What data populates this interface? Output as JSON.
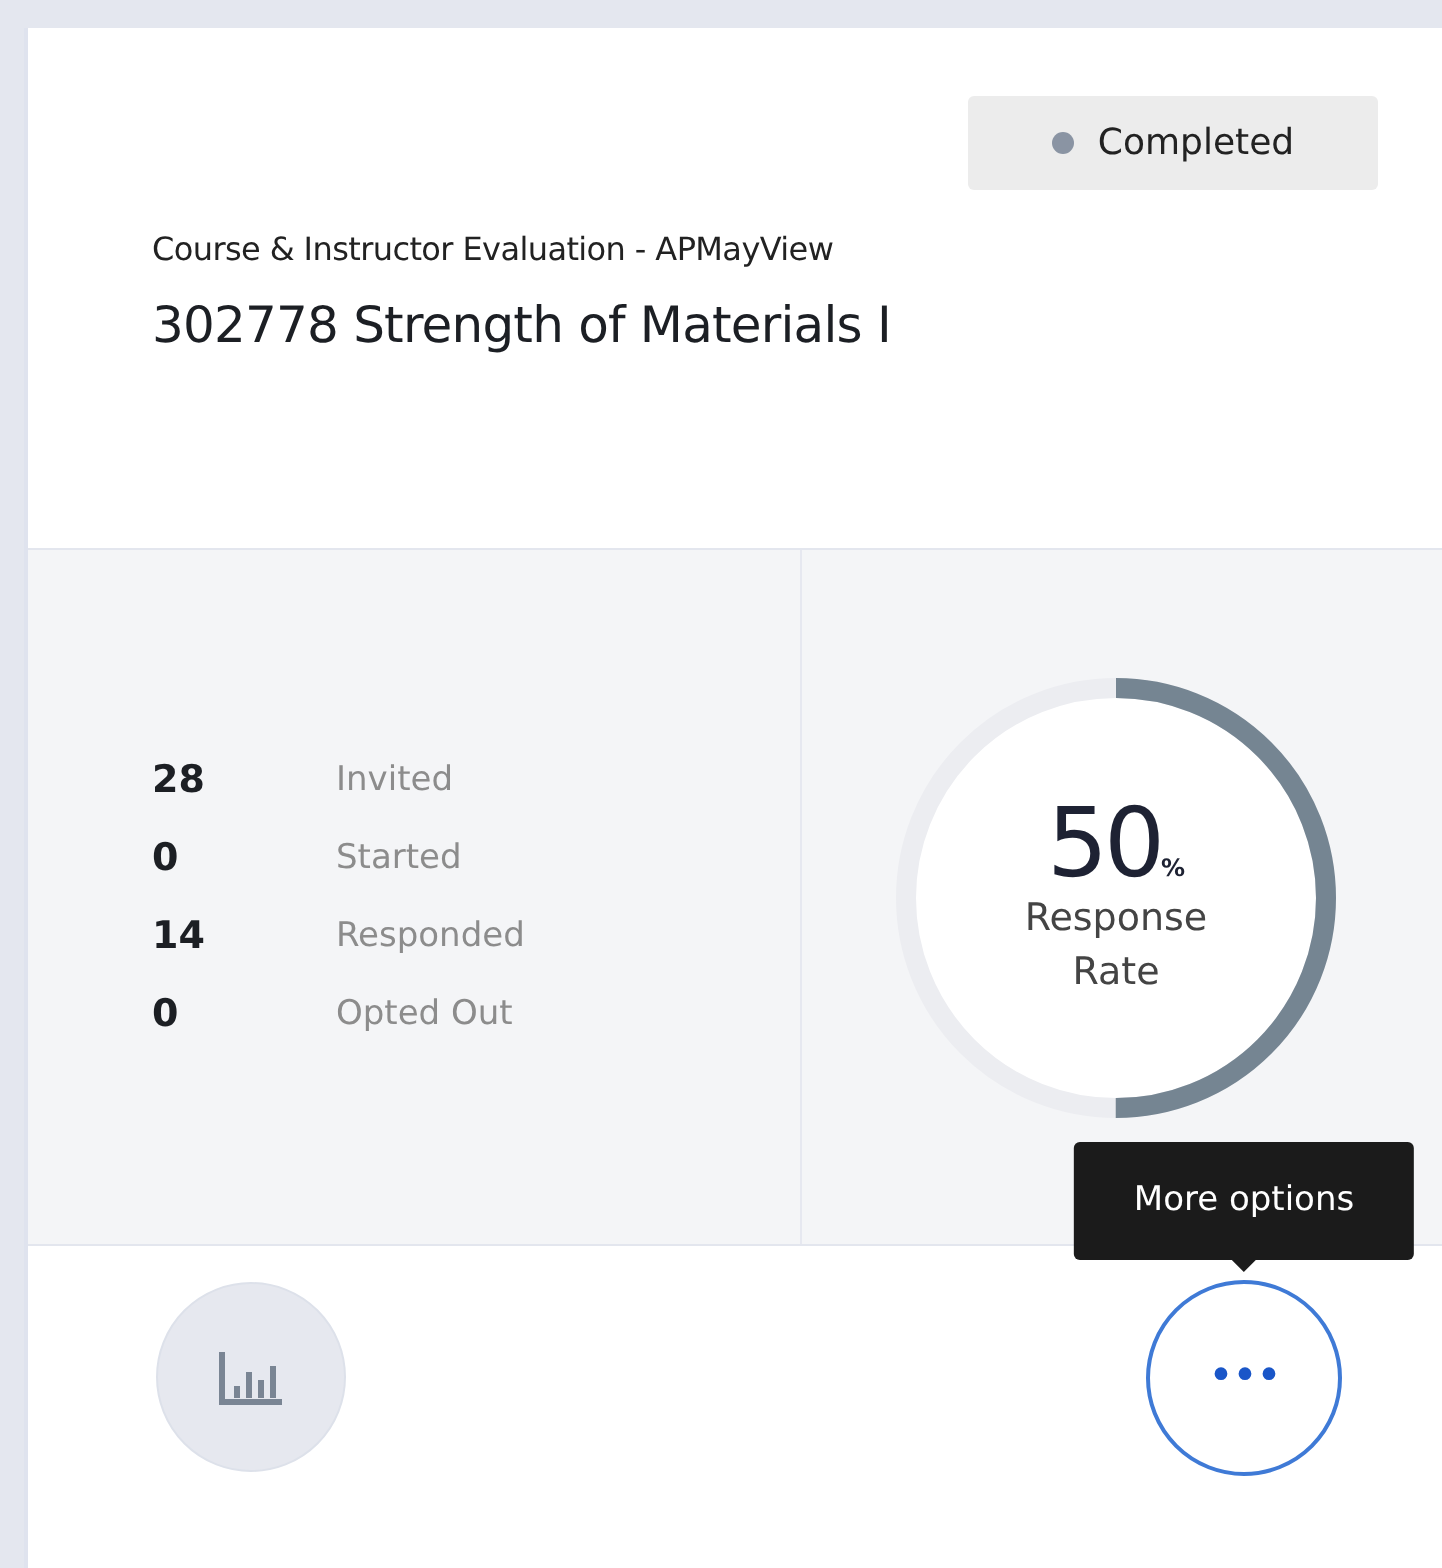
{
  "status": {
    "label": "Completed",
    "color": "#8a94a3"
  },
  "subtitle": "Course & Instructor Evaluation - APMayView",
  "title": "302778 Strength of Materials I",
  "stats": [
    {
      "value": "28",
      "label": "Invited"
    },
    {
      "value": "0",
      "label": "Started"
    },
    {
      "value": "14",
      "label": "Responded"
    },
    {
      "value": "0",
      "label": "Opted Out"
    }
  ],
  "response_rate": {
    "value": "50",
    "unit": "%",
    "label": "Response Rate",
    "level": 0.5
  },
  "tooltip": "More options",
  "more_button": {
    "label": "•••"
  }
}
